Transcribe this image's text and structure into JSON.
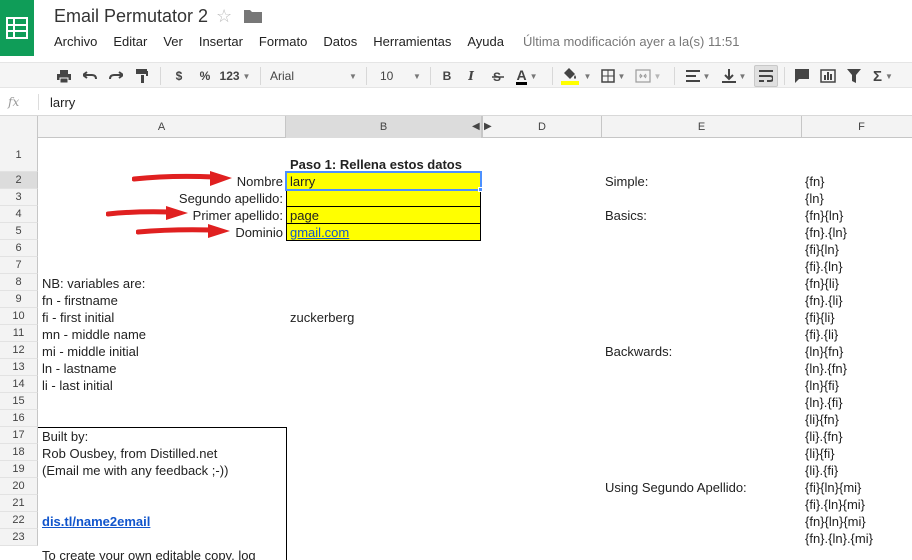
{
  "doc": {
    "title": "Email Permutator 2",
    "last_modified": "Última modificación ayer a la(s) 11:51"
  },
  "menu": [
    "Archivo",
    "Editar",
    "Ver",
    "Insertar",
    "Formato",
    "Datos",
    "Herramientas",
    "Ayuda"
  ],
  "toolbar": {
    "currency": "$",
    "percent": "%",
    "number_format": "123",
    "font": "Arial",
    "font_size": "10",
    "bold": "B",
    "italic": "I",
    "text_color_letter": "A"
  },
  "formula_bar": {
    "fx": "fx",
    "value": "larry"
  },
  "columns": [
    "A",
    "B",
    "D",
    "E",
    "F"
  ],
  "rows": [
    "1",
    "2",
    "3",
    "4",
    "5",
    "6",
    "7",
    "8",
    "9",
    "10",
    "11",
    "12",
    "13",
    "14",
    "15",
    "16",
    "17",
    "18",
    "19",
    "20",
    "21",
    "22",
    "23"
  ],
  "cells": {
    "b1": "Paso 1: Rellena estos datos",
    "a2": "Nombre",
    "a3": "Segundo apellido:",
    "a4": "Primer apellido:",
    "a5": "Dominio",
    "b2": "larry",
    "b4": "page",
    "b5": "gmail.com",
    "b10": "zuckerberg",
    "a8": "NB: variables are:",
    "a9": "fn - firstname",
    "a10": "fi - first initial",
    "a11": "mn - middle name",
    "a12": "mi - middle initial",
    "a13": "ln - lastname",
    "a14": "li - last initial",
    "a17": "Built by:",
    "a18": "Rob Ousbey, from Distilled.net",
    "a19": "(Email me with any feedback ;-))",
    "a22": "dis.tl/name2email",
    "a23": "To create your own editable copy, log",
    "e2": "Simple:",
    "e4": "Basics:",
    "e12": "Backwards:",
    "e20": "Using Segundo Apellido:",
    "f": [
      "{fn}",
      "{ln}",
      "{fn}{ln}",
      "{fn}.{ln}",
      "{fi}{ln}",
      "{fi}.{ln}",
      "{fn}{li}",
      "{fn}.{li}",
      "{fi}{li}",
      "{fi}.{li}",
      "{ln}{fn}",
      "{ln}.{fn}",
      "{ln}{fi}",
      "{ln}.{fi}",
      "{li}{fn}",
      "{li}.{fn}",
      "{li}{fi}",
      "{li}.{fi}",
      "{fi}{ln}{mi}",
      "{fi}.{ln}{mi}",
      "{fn}{ln}{mi}",
      "{fn}.{ln}.{mi}"
    ]
  },
  "colors": {
    "brand": "#0f9d58",
    "highlight": "#ffff00",
    "arrow": "#e02020",
    "selection": "#4d90fe",
    "link": "#1155cc"
  }
}
